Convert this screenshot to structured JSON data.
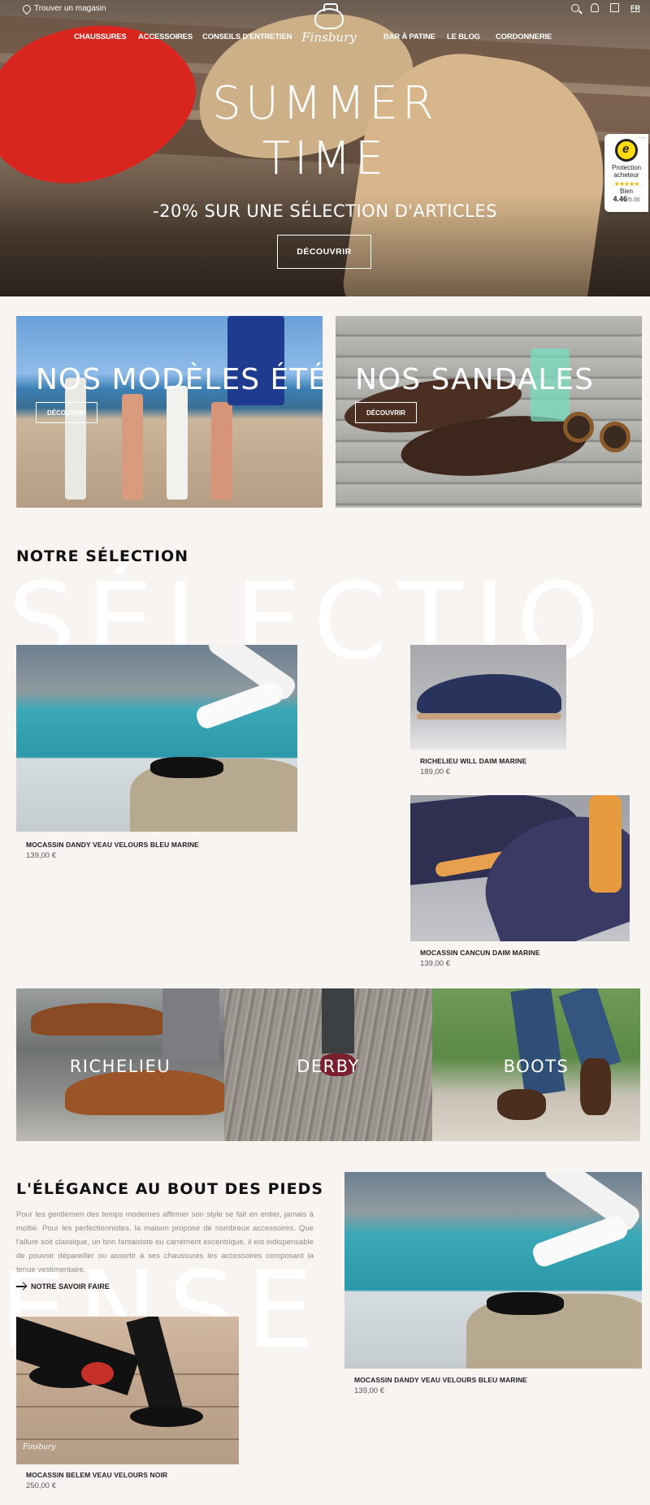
{
  "topbar": {
    "store_link": "Trouver un magasin",
    "lang": "FR",
    "icons": [
      "pin-icon",
      "search-icon",
      "user-icon",
      "bag-icon"
    ]
  },
  "nav": {
    "items": [
      "CHAUSSURES",
      "ACCESSOIRES",
      "CONSEILS D'ENTRETIEN",
      "BAR À PATINE",
      "LE BLOG",
      "CORDONNERIE"
    ],
    "logo": "Finsbury"
  },
  "hero": {
    "title_line1": "SUMMER",
    "title_line2": "TIME",
    "subtitle": "-20% SUR UNE SÉLECTION D'ARTICLES",
    "button": "DÉCOUVRIR"
  },
  "trusted": {
    "label": "Protection acheteur",
    "stars": "★★★★★",
    "rating_text": "Bien",
    "score": "4.46",
    "score_max": "/5.00"
  },
  "categories": [
    {
      "title": "NOS MODÈLES ÉTÉ",
      "button": "DÉCOUVRIR"
    },
    {
      "title": "NOS SANDALES",
      "button": "DÉCOUVRIR"
    }
  ],
  "selection": {
    "title": "NOTRE SÉLECTION",
    "ghost": "SÉLECTIO",
    "products": [
      {
        "name": "MOCASSIN DANDY VEAU VELOURS BLEU MARINE",
        "price": "139,00 €"
      },
      {
        "name": "RICHELIEU WILL DAIM MARINE",
        "price": "189,00 €"
      },
      {
        "name": "MOCASSIN CANCUN DAIM MARINE",
        "price": "139,00 €"
      }
    ]
  },
  "styles": [
    "RICHELIEU",
    "DERBY",
    "BOOTS"
  ],
  "elegance": {
    "title": "L'ÉLÉGANCE AU BOUT DES PIEDS",
    "ghost": "ENSE",
    "text": "Pour les gentlemen des temps modernes affirmer son style se fait en entier, jamais à moitié. Pour les perfectionnistes, la maison propose de nombreux accessoires. Que l'allure soit classique, un brin fantaisiste ou carrément excentrique, il est indispensable de pouvoir dépareiller ou assortir à ses chaussures les accessoires composant la tenue vestimentaire.",
    "link": "NOTRE SAVOIR FAIRE",
    "products": [
      {
        "name": "MOCASSIN DANDY VEAU VELOURS BLEU MARINE",
        "price": "139,00 €"
      },
      {
        "name": "MOCASSIN BELEM VEAU VELOURS NOIR",
        "price": "250,00 €"
      }
    ],
    "watermark": "Finsbury"
  }
}
